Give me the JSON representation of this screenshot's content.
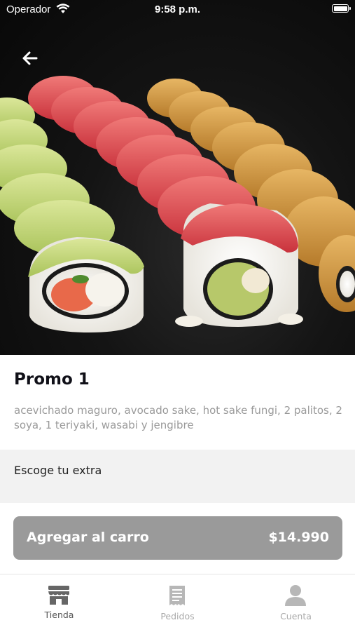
{
  "status_bar": {
    "carrier": "Operador",
    "time": "9:58 p.m."
  },
  "hero": {
    "image_icon": "sushi-rolls-photo",
    "back_icon": "arrow-left-icon"
  },
  "product": {
    "title": "Promo 1",
    "description": "acevichado maguro, avocado sake, hot sake fungi, 2 palitos, 2 soya, 1 teriyaki, wasabi y jengibre"
  },
  "extras": {
    "label": "Escoge tu extra"
  },
  "cart_button": {
    "label": "Agregar al carro",
    "price": "$14.990",
    "color": "#9a9a9a"
  },
  "tabs": [
    {
      "label": "Tienda",
      "icon": "store-icon",
      "active": true
    },
    {
      "label": "Pedidos",
      "icon": "receipt-icon",
      "active": false
    },
    {
      "label": "Cuenta",
      "icon": "user-icon",
      "active": false
    }
  ]
}
